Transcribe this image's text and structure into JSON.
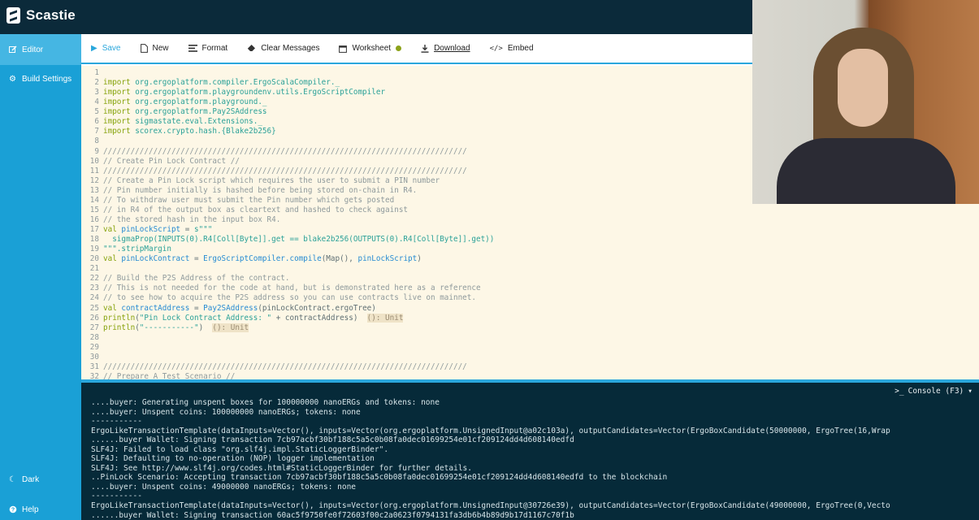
{
  "app": {
    "name": "Scastie"
  },
  "sidebar": {
    "items": [
      {
        "label": "Editor",
        "icon": "edit-icon",
        "active": true
      },
      {
        "label": "Build Settings",
        "icon": "gear-icon",
        "active": false
      }
    ],
    "bottom": [
      {
        "label": "Dark",
        "icon": "moon-icon"
      },
      {
        "label": "Help",
        "icon": "help-icon"
      }
    ]
  },
  "toolbar": {
    "save": "Save",
    "new": "New",
    "format": "Format",
    "clear": "Clear Messages",
    "worksheet": "Worksheet",
    "download": "Download",
    "embed": "Embed",
    "worksheet_status_color": "#8ca21a"
  },
  "code_lines": [
    {
      "n": "1",
      "parts": []
    },
    {
      "n": "2",
      "parts": [
        {
          "t": "kw",
          "v": "import"
        },
        {
          "t": "st",
          "v": " org.ergoplatform.compiler.ErgoScalaCompiler._"
        }
      ]
    },
    {
      "n": "3",
      "parts": [
        {
          "t": "kw",
          "v": "import"
        },
        {
          "t": "st",
          "v": " org.ergoplatform.playgroundenv.utils.ErgoScriptCompiler"
        }
      ]
    },
    {
      "n": "4",
      "parts": [
        {
          "t": "kw",
          "v": "import"
        },
        {
          "t": "st",
          "v": " org.ergoplatform.playground._"
        }
      ]
    },
    {
      "n": "5",
      "parts": [
        {
          "t": "kw",
          "v": "import"
        },
        {
          "t": "st",
          "v": " org.ergoplatform.Pay2SAddress"
        }
      ]
    },
    {
      "n": "6",
      "parts": [
        {
          "t": "kw",
          "v": "import"
        },
        {
          "t": "st",
          "v": " sigmastate.eval.Extensions._"
        }
      ]
    },
    {
      "n": "7",
      "parts": [
        {
          "t": "kw",
          "v": "import"
        },
        {
          "t": "st",
          "v": " scorex.crypto.hash.{Blake2b256}"
        }
      ]
    },
    {
      "n": "8",
      "parts": []
    },
    {
      "n": "9",
      "parts": [
        {
          "t": "cm",
          "v": "////////////////////////////////////////////////////////////////////////////////"
        }
      ]
    },
    {
      "n": "10",
      "parts": [
        {
          "t": "cm",
          "v": "// Create Pin Lock Contract //"
        }
      ]
    },
    {
      "n": "11",
      "parts": [
        {
          "t": "cm",
          "v": "////////////////////////////////////////////////////////////////////////////////"
        }
      ]
    },
    {
      "n": "12",
      "parts": [
        {
          "t": "cm",
          "v": "// Create a Pin Lock script which requires the user to submit a PIN number"
        }
      ]
    },
    {
      "n": "13",
      "parts": [
        {
          "t": "cm",
          "v": "// Pin number initially is hashed before being stored on-chain in R4."
        }
      ]
    },
    {
      "n": "14",
      "parts": [
        {
          "t": "cm",
          "v": "// To withdraw user must submit the Pin number which gets posted"
        }
      ]
    },
    {
      "n": "15",
      "parts": [
        {
          "t": "cm",
          "v": "// in R4 of the output box as cleartext and hashed to check against"
        }
      ]
    },
    {
      "n": "16",
      "parts": [
        {
          "t": "cm",
          "v": "// the stored hash in the input box R4."
        }
      ]
    },
    {
      "n": "17",
      "parts": [
        {
          "t": "kw",
          "v": "val"
        },
        {
          "t": "fn",
          "v": " pinLockScript"
        },
        {
          "t": "pl",
          "v": " = "
        },
        {
          "t": "st",
          "v": "s\"\"\""
        }
      ]
    },
    {
      "n": "18",
      "parts": [
        {
          "t": "st",
          "v": "  sigmaProp(INPUTS(0).R4[Coll[Byte]].get == blake2b256(OUTPUTS(0).R4[Coll[Byte]].get))"
        }
      ]
    },
    {
      "n": "19",
      "parts": [
        {
          "t": "st",
          "v": "\"\"\".stripMargin"
        }
      ]
    },
    {
      "n": "20",
      "parts": [
        {
          "t": "kw",
          "v": "val"
        },
        {
          "t": "fn",
          "v": " pinLockContract"
        },
        {
          "t": "pl",
          "v": " = "
        },
        {
          "t": "fn",
          "v": "ErgoScriptCompiler.compile"
        },
        {
          "t": "pl",
          "v": "(Map(), "
        },
        {
          "t": "fn",
          "v": "pinLockScript"
        },
        {
          "t": "pl",
          "v": ")"
        }
      ]
    },
    {
      "n": "21",
      "parts": []
    },
    {
      "n": "22",
      "parts": [
        {
          "t": "cm",
          "v": "// Build the P2S Address of the contract."
        }
      ]
    },
    {
      "n": "23",
      "parts": [
        {
          "t": "cm",
          "v": "// This is not needed for the code at hand, but is demonstrated here as a reference"
        }
      ]
    },
    {
      "n": "24",
      "parts": [
        {
          "t": "cm",
          "v": "// to see how to acquire the P2S address so you can use contracts live on mainnet."
        }
      ]
    },
    {
      "n": "25",
      "parts": [
        {
          "t": "kw",
          "v": "val"
        },
        {
          "t": "fn",
          "v": " contractAddress"
        },
        {
          "t": "pl",
          "v": " = "
        },
        {
          "t": "fn",
          "v": "Pay2SAddress"
        },
        {
          "t": "pl",
          "v": "(pinLockContract.ergoTree)"
        }
      ]
    },
    {
      "n": "26",
      "parts": [
        {
          "t": "kw",
          "v": "println"
        },
        {
          "t": "pl",
          "v": "("
        },
        {
          "t": "st",
          "v": "\"Pin Lock Contract Address: \""
        },
        {
          "t": "pl",
          "v": " + contractAddress)  "
        },
        {
          "t": "ann",
          "v": "(): Unit"
        }
      ]
    },
    {
      "n": "27",
      "parts": [
        {
          "t": "kw",
          "v": "println"
        },
        {
          "t": "pl",
          "v": "("
        },
        {
          "t": "st",
          "v": "\"-----------\""
        },
        {
          "t": "pl",
          "v": ")  "
        },
        {
          "t": "ann",
          "v": "(): Unit"
        }
      ]
    },
    {
      "n": "28",
      "parts": []
    },
    {
      "n": "29",
      "parts": []
    },
    {
      "n": "30",
      "parts": []
    },
    {
      "n": "31",
      "parts": [
        {
          "t": "cm",
          "v": "////////////////////////////////////////////////////////////////////////////////"
        }
      ]
    },
    {
      "n": "32",
      "parts": [
        {
          "t": "cm",
          "v": "// Prepare A Test Scenario //"
        }
      ]
    }
  ],
  "console": {
    "toggle_label": "Console (F3)",
    "lines": [
      "....buyer: Generating unspent boxes for 100000000 nanoERGs and tokens: none",
      "....buyer: Unspent coins: 100000000 nanoERGs; tokens: none",
      "-----------",
      "ErgoLikeTransactionTemplate(dataInputs=Vector(), inputs=Vector(org.ergoplatform.UnsignedInput@a02c103a), outputCandidates=Vector(ErgoBoxCandidate(50000000, ErgoTree(16,Wrap",
      "......buyer Wallet: Signing transaction 7cb97acbf30bf188c5a5c0b08fa0dec01699254e01cf209124dd4d608140edfd",
      "SLF4J: Failed to load class \"org.slf4j.impl.StaticLoggerBinder\".",
      "SLF4J: Defaulting to no-operation (NOP) logger implementation",
      "SLF4J: See http://www.slf4j.org/codes.html#StaticLoggerBinder for further details.",
      "..PinLock Scenario: Accepting transaction 7cb97acbf30bf188c5a5c0b08fa0dec01699254e01cf209124dd4d608140edfd to the blockchain",
      "....buyer: Unspent coins: 49000000 nanoERGs; tokens: none",
      "-----------",
      "ErgoLikeTransactionTemplate(dataInputs=Vector(), inputs=Vector(org.ergoplatform.UnsignedInput@30726e39), outputCandidates=Vector(ErgoBoxCandidate(49000000, ErgoTree(0,Vecto",
      "......buyer Wallet: Signing transaction 60ac5f9750fe0f72603f00c2a0623f0794131fa3db6b4b89d9b17d1167c70f1b"
    ]
  }
}
